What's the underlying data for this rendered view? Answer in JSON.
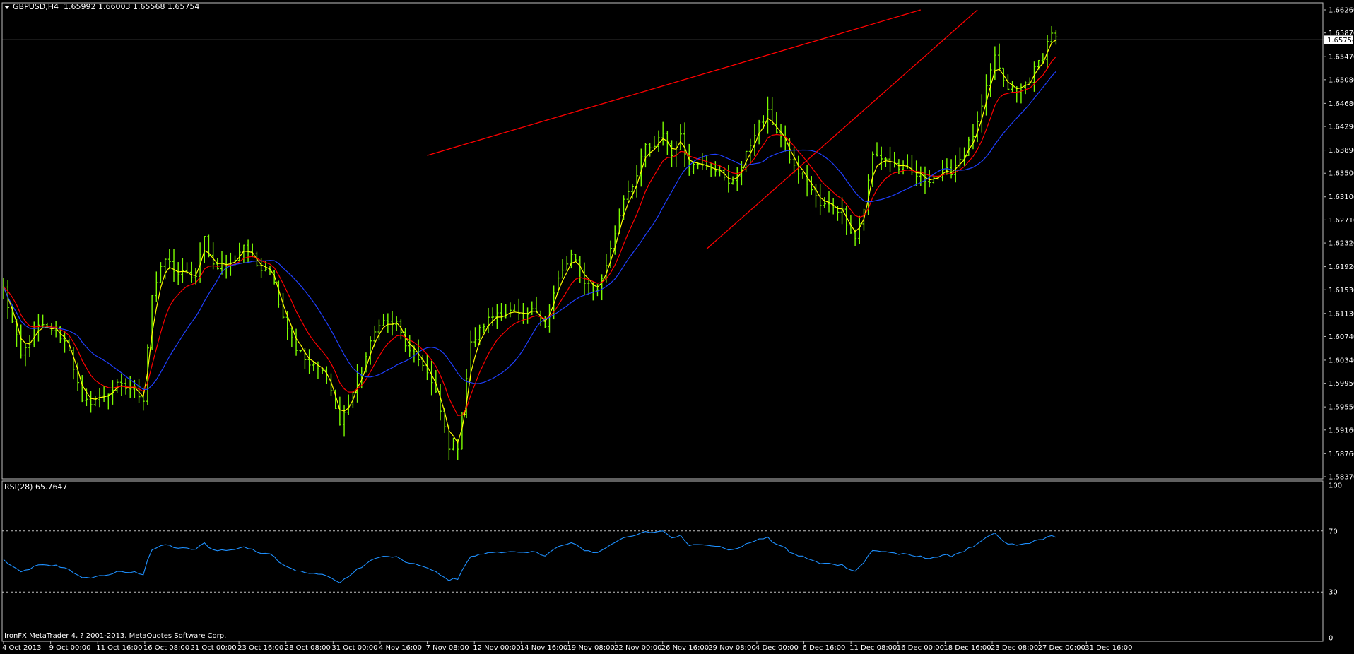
{
  "header": {
    "symbol": "GBPUSD,H4",
    "ohlc": "1.65992 1.66003 1.65568 1.65754"
  },
  "rsi_label": "RSI(28) 65.7647",
  "copyright": "IronFX MetaTrader 4, ? 2001-2013, MetaQuotes Software Corp.",
  "colors": {
    "background": "#000000",
    "frame": "#c0c0c0",
    "candles": "#7cfc00",
    "ma_fast": "#ffff00",
    "ma_mid": "#ff0000",
    "ma_slow": "#1f3fff",
    "trendlines": "#ff0000",
    "rsi": "#1e90ff",
    "text": "#ffffff"
  },
  "chart_data": {
    "type": "candlestick",
    "symbol": "GBPUSD",
    "timeframe": "H4",
    "current_price": "1.65754",
    "price_ticks": [
      "1.66260",
      "1.65870",
      "1.65470",
      "1.65080",
      "1.64680",
      "1.64290",
      "1.63890",
      "1.63500",
      "1.63100",
      "1.62710",
      "1.62320",
      "1.61920",
      "1.61530",
      "1.61130",
      "1.60740",
      "1.60340",
      "1.59950",
      "1.59550",
      "1.59160",
      "1.58760",
      "1.58370"
    ],
    "ylim": [
      1.5837,
      1.6626
    ],
    "time_ticks": [
      "4 Oct 2013",
      "9 Oct 00:00",
      "11 Oct 16:00",
      "16 Oct 08:00",
      "21 Oct 00:00",
      "23 Oct 16:00",
      "28 Oct 08:00",
      "31 Oct 00:00",
      "4 Nov 16:00",
      "7 Nov 08:00",
      "12 Nov 00:00",
      "14 Nov 16:00",
      "19 Nov 08:00",
      "22 Nov 00:00",
      "26 Nov 16:00",
      "29 Nov 08:00",
      "4 Dec 00:00",
      "6 Dec 16:00",
      "11 Dec 08:00",
      "16 Dec 00:00",
      "18 Dec 16:00",
      "23 Dec 08:00",
      "27 Dec 00:00",
      "31 Dec 16:00"
    ],
    "price_path": [
      [
        0,
        1.6155
      ],
      [
        4,
        1.604
      ],
      [
        8,
        1.609
      ],
      [
        12,
        1.6085
      ],
      [
        15,
        1.6055
      ],
      [
        18,
        1.596
      ],
      [
        22,
        1.597
      ],
      [
        26,
        1.599
      ],
      [
        30,
        1.5985
      ],
      [
        32,
        1.597
      ],
      [
        34,
        1.6145
      ],
      [
        37,
        1.6205
      ],
      [
        40,
        1.618
      ],
      [
        44,
        1.6175
      ],
      [
        46,
        1.624
      ],
      [
        48,
        1.6195
      ],
      [
        52,
        1.6195
      ],
      [
        55,
        1.623
      ],
      [
        58,
        1.6195
      ],
      [
        61,
        1.619
      ],
      [
        64,
        1.611
      ],
      [
        67,
        1.6055
      ],
      [
        70,
        1.6025
      ],
      [
        74,
        1.601
      ],
      [
        77,
        1.5925
      ],
      [
        80,
        1.598
      ],
      [
        83,
        1.604
      ],
      [
        86,
        1.61
      ],
      [
        90,
        1.6095
      ],
      [
        93,
        1.6045
      ],
      [
        96,
        1.603
      ],
      [
        99,
        1.5975
      ],
      [
        102,
        1.589
      ],
      [
        104,
        1.589
      ],
      [
        107,
        1.606
      ],
      [
        110,
        1.6095
      ],
      [
        113,
        1.6115
      ],
      [
        116,
        1.6115
      ],
      [
        119,
        1.6105
      ],
      [
        122,
        1.612
      ],
      [
        124,
        1.6095
      ],
      [
        127,
        1.617
      ],
      [
        130,
        1.621
      ],
      [
        133,
        1.617
      ],
      [
        136,
        1.615
      ],
      [
        139,
        1.622
      ],
      [
        142,
        1.631
      ],
      [
        145,
        1.6345
      ],
      [
        147,
        1.6395
      ],
      [
        149,
        1.639
      ],
      [
        151,
        1.642
      ],
      [
        153,
        1.638
      ],
      [
        155,
        1.641
      ],
      [
        157,
        1.636
      ],
      [
        160,
        1.637
      ],
      [
        163,
        1.636
      ],
      [
        166,
        1.633
      ],
      [
        169,
        1.636
      ],
      [
        172,
        1.642
      ],
      [
        175,
        1.645
      ],
      [
        178,
        1.641
      ],
      [
        181,
        1.636
      ],
      [
        184,
        1.6335
      ],
      [
        187,
        1.6295
      ],
      [
        190,
        1.6295
      ],
      [
        192,
        1.6285
      ],
      [
        195,
        1.624
      ],
      [
        197,
        1.629
      ],
      [
        199,
        1.638
      ],
      [
        202,
        1.6375
      ],
      [
        205,
        1.636
      ],
      [
        208,
        1.635
      ],
      [
        211,
        1.634
      ],
      [
        214,
        1.6345
      ],
      [
        217,
        1.6355
      ],
      [
        220,
        1.6385
      ],
      [
        223,
        1.643
      ],
      [
        225,
        1.649
      ],
      [
        227,
        1.655
      ],
      [
        229,
        1.65
      ],
      [
        232,
        1.6485
      ],
      [
        235,
        1.651
      ],
      [
        238,
        1.655
      ],
      [
        240,
        1.659
      ],
      [
        241,
        1.6575
      ]
    ],
    "series": [
      {
        "name": "",
        "color": "#ffff00",
        "values": []
      },
      {
        "name": "",
        "color": "#ff0000",
        "values": []
      },
      {
        "name": "",
        "color": "#1f3fff",
        "values": []
      }
    ],
    "trendlines": [
      {
        "from": [
          97,
          1.638
        ],
        "to": [
          210,
          1.6626
        ]
      },
      {
        "from": [
          161,
          1.6222
        ],
        "to": [
          223,
          1.6626
        ]
      }
    ],
    "rsi": {
      "period": 28,
      "value": 65.7647,
      "levels": [
        30,
        70
      ],
      "ylim": [
        0,
        100
      ],
      "ticks": [
        "100",
        "70",
        "30",
        "0"
      ]
    }
  }
}
